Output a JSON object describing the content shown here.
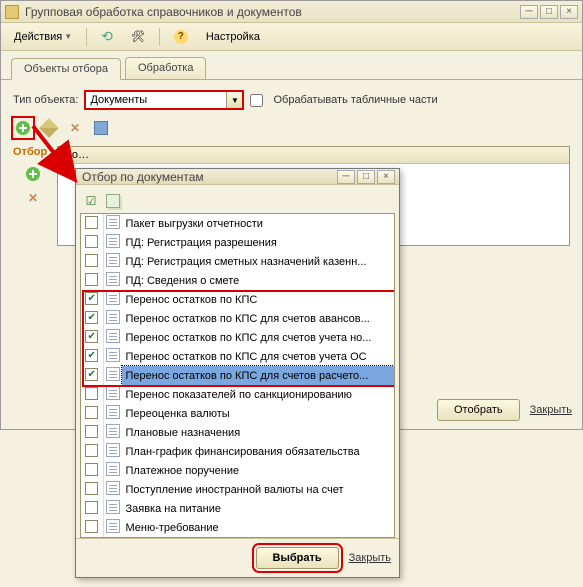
{
  "main": {
    "title": "Групповая обработка справочников и документов",
    "toolbar": {
      "actions_label": "Действия",
      "settings_label": "Настройка"
    },
    "tabs": [
      {
        "label": "Объекты отбора",
        "active": true
      },
      {
        "label": "Обработка",
        "active": false
      }
    ],
    "type_label": "Тип объекта:",
    "type_value": "Документы",
    "process_tabular_label": "Обрабатывать табличные части",
    "process_tabular_checked": false,
    "section_label": "Отбор",
    "grid_header_col": "По…",
    "buttons": {
      "select": "Отобрать",
      "close": "Закрыть"
    }
  },
  "dialog": {
    "title": "Отбор по документам",
    "items": [
      {
        "checked": false,
        "label": "Пакет выгрузки отчетности"
      },
      {
        "checked": false,
        "label": "ПД: Регистрация разрешения"
      },
      {
        "checked": false,
        "label": "ПД: Регистрация сметных назначений казенн..."
      },
      {
        "checked": false,
        "label": "ПД: Сведения о смете"
      },
      {
        "checked": true,
        "label": "Перенос остатков по КПС"
      },
      {
        "checked": true,
        "label": "Перенос остатков по КПС для счетов авансов..."
      },
      {
        "checked": true,
        "label": "Перенос остатков по КПС для счетов учета но..."
      },
      {
        "checked": true,
        "label": "Перенос остатков по КПС для счетов учета ОС"
      },
      {
        "checked": true,
        "label": "Перенос остатков по КПС для счетов расчето...",
        "selected": true
      },
      {
        "checked": false,
        "label": "Перенос показателей по санкционированию"
      },
      {
        "checked": false,
        "label": "Переоценка валюты"
      },
      {
        "checked": false,
        "label": "Плановые назначения"
      },
      {
        "checked": false,
        "label": "План-график финансирования обязательства"
      },
      {
        "checked": false,
        "label": "Платежное поручение"
      },
      {
        "checked": false,
        "label": "Поступление иностранной валюты на счет"
      },
      {
        "checked": false,
        "label": "Заявка на питание"
      },
      {
        "checked": false,
        "label": "Меню-требование"
      }
    ],
    "highlight": {
      "start": 4,
      "end": 8
    },
    "buttons": {
      "choose": "Выбрать",
      "close": "Закрыть"
    }
  }
}
